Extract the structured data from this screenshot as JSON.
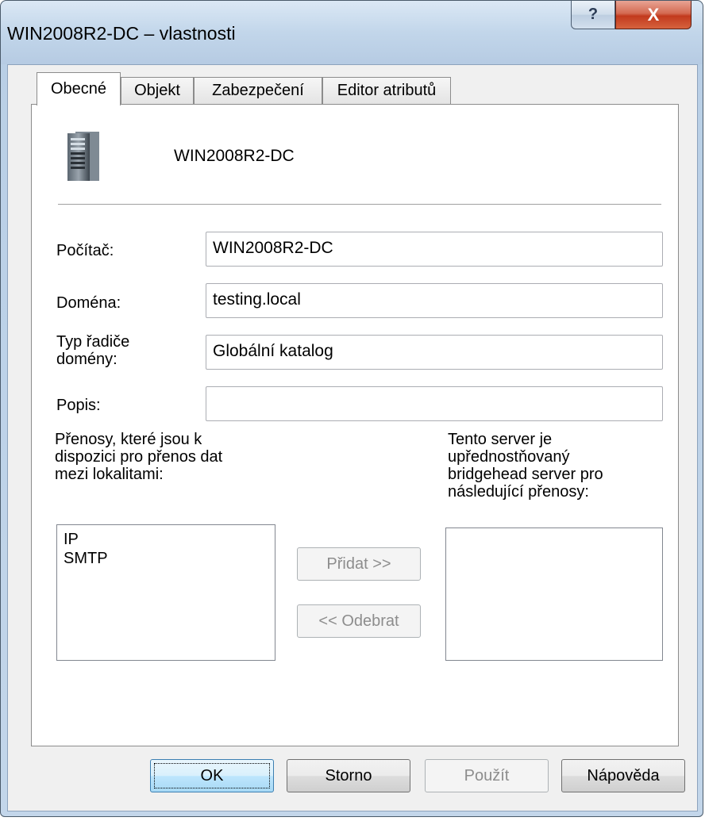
{
  "window": {
    "title": "WIN2008R2-DC – vlastnosti",
    "help_glyph": "?",
    "close_glyph": "X"
  },
  "tabs": [
    {
      "label": "Obecné",
      "active": true
    },
    {
      "label": "Objekt",
      "active": false
    },
    {
      "label": "Zabezpečení",
      "active": false
    },
    {
      "label": "Editor atributů",
      "active": false
    }
  ],
  "header": {
    "computer_name": "WIN2008R2-DC",
    "icon": "server-icon"
  },
  "form": {
    "computer_label": "Počítač:",
    "computer_value": "WIN2008R2-DC",
    "domain_label": "Doména:",
    "domain_value": "testing.local",
    "dc_type_label_line1": "Typ řadiče",
    "dc_type_label_line2": "domény:",
    "dc_type_value": "Globální katalog",
    "description_label": "Popis:",
    "description_value": ""
  },
  "transports": {
    "available_label_line1": "Přenosy, které jsou k",
    "available_label_line2": "dispozici pro přenos dat",
    "available_label_line3": "mezi lokalitami:",
    "available_items": [
      "IP",
      "SMTP"
    ],
    "preferred_label_line1": "Tento server je",
    "preferred_label_line2": "upřednostňovaný",
    "preferred_label_line3": "bridgehead server pro",
    "preferred_label_line4": "následující přenosy:",
    "preferred_items": [],
    "add_button": "Přidat >>",
    "remove_button": "<< Odebrat"
  },
  "buttons": {
    "ok": "OK",
    "cancel": "Storno",
    "apply": "Použít",
    "help": "Nápověda"
  },
  "colors": {
    "close_button": "#c23a1d",
    "default_button": "#3c7fb1"
  }
}
